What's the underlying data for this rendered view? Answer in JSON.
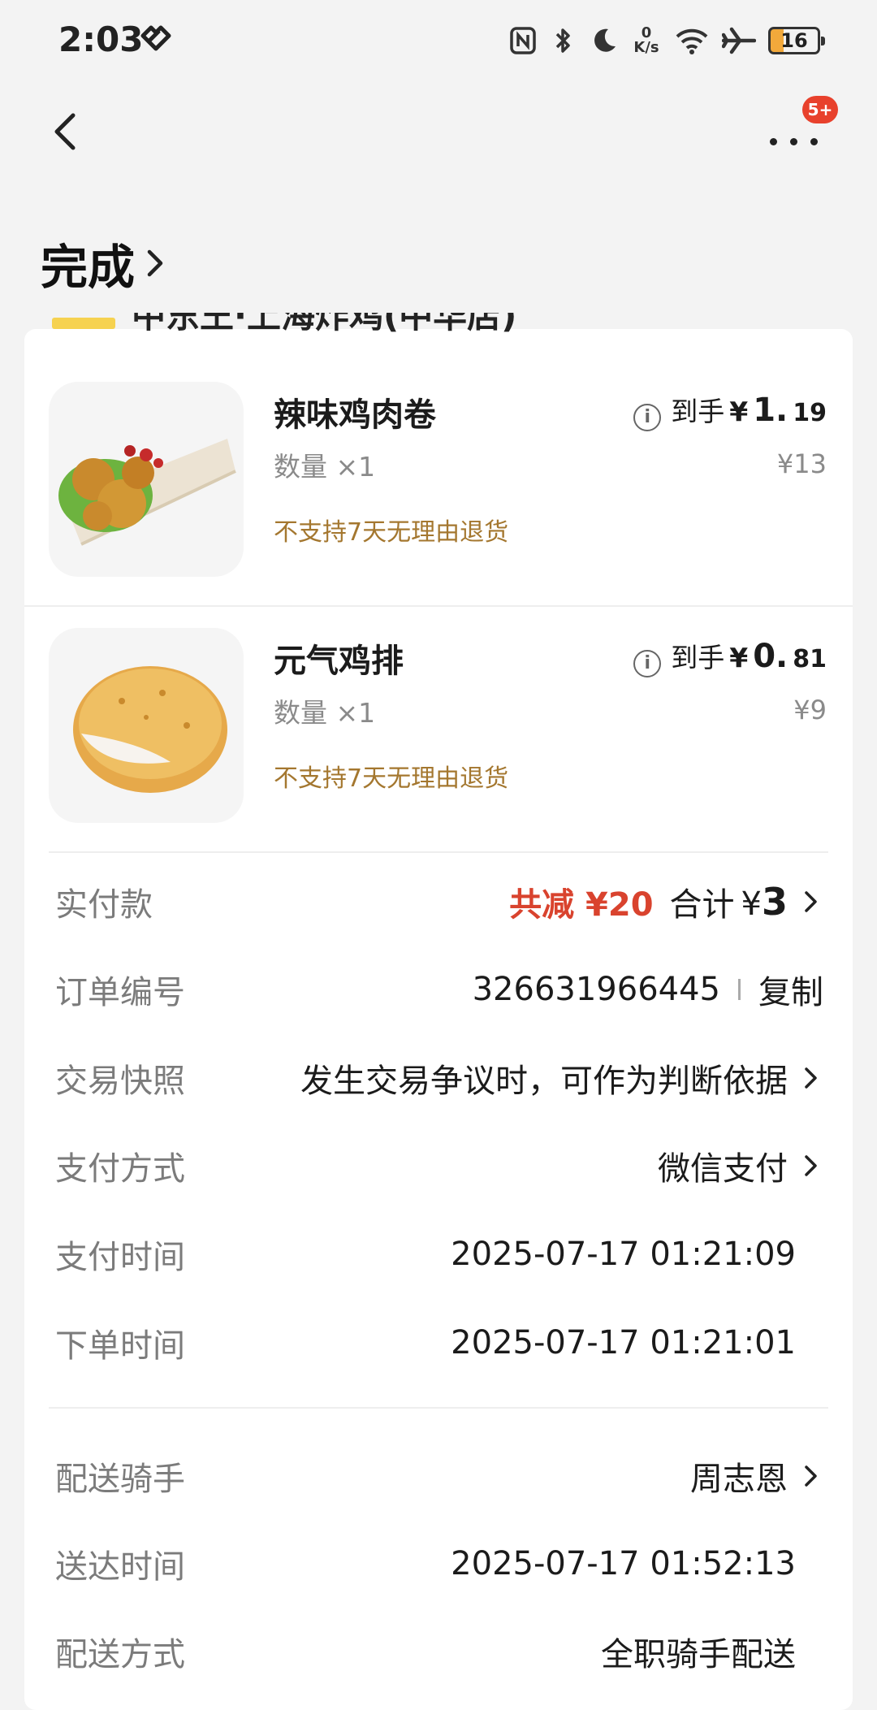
{
  "status_bar": {
    "time": "2:03",
    "speed_value": "0",
    "speed_unit": "K/s",
    "battery": "16"
  },
  "nav": {
    "badge": "5+"
  },
  "order": {
    "status": "完成"
  },
  "store": {
    "name": "中东王·上海炸鸡(中华店)"
  },
  "items": [
    {
      "name": "辣味鸡肉卷",
      "quantity": "数量 ×1",
      "policy": "不支持7天无理由退货",
      "price_label": "到手",
      "price_yen": "¥",
      "price_int": "1.",
      "price_dec": "19",
      "original_price": "¥13"
    },
    {
      "name": "元气鸡排",
      "quantity": "数量 ×1",
      "policy": "不支持7天无理由退货",
      "price_label": "到手",
      "price_yen": "¥",
      "price_int": "0.",
      "price_dec": "81",
      "original_price": "¥9"
    }
  ],
  "details": {
    "paid": {
      "label": "实付款",
      "discount": "共减 ¥20",
      "total_label": "合计",
      "total_yen": "¥",
      "total_value": "3"
    },
    "order_no": {
      "label": "订单编号",
      "value": "326631966445",
      "copy": "复制"
    },
    "snapshot": {
      "label": "交易快照",
      "value": "发生交易争议时，可作为判断依据"
    },
    "pay_method": {
      "label": "支付方式",
      "value": "微信支付"
    },
    "pay_time": {
      "label": "支付时间",
      "value": "2025-07-17 01:21:09"
    },
    "order_time": {
      "label": "下单时间",
      "value": "2025-07-17 01:21:01"
    },
    "rider": {
      "label": "配送骑手",
      "value": "周志恩"
    },
    "delivered_time": {
      "label": "送达时间",
      "value": "2025-07-17 01:52:13"
    },
    "delivery_method": {
      "label": "配送方式",
      "value": "全职骑手配送"
    }
  },
  "colors": {
    "accent_red": "#d9432e",
    "policy_brown": "#a4772f",
    "store_yellow": "#f6d250"
  }
}
